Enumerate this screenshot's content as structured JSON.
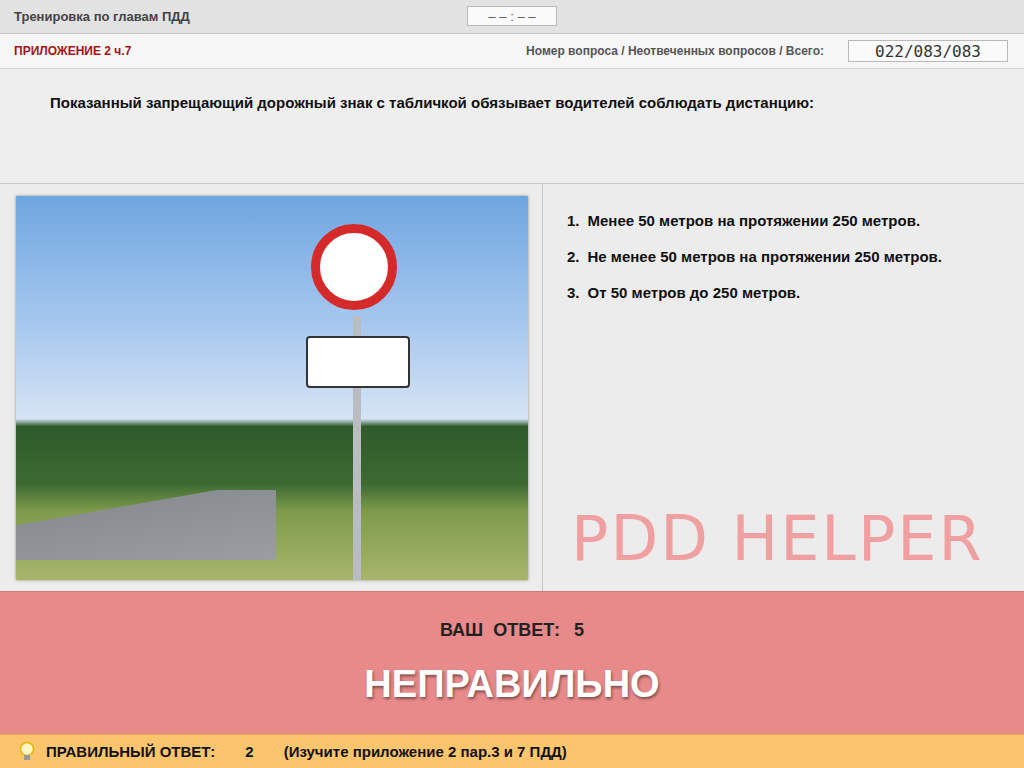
{
  "header": {
    "title": "Тренировка по главам ПДД",
    "timer": "– – : – –"
  },
  "info": {
    "section": "ПРИЛОЖЕНИЕ 2 ч.7",
    "counter_label": "Номер вопроса / Неотвеченных вопросов / Всего:",
    "counter": "022/083/083"
  },
  "question": "Показанный запрещающий дорожный знак с табличкой обязывает водителей соблюдать дистанцию:",
  "answers": [
    {
      "number": "1.",
      "text": "Менее 50 метров на протяжении 250 метров."
    },
    {
      "number": "2.",
      "text": "Не менее 50 метров на протяжении 250 метров."
    },
    {
      "number": "3.",
      "text": "От 50 метров до 250 метров."
    }
  ],
  "watermark": "PDD HELPER",
  "result": {
    "label": "ВАШ  ОТВЕТ:",
    "value": "5",
    "verdict": "НЕПРАВИЛЬНО"
  },
  "hint": {
    "label": "ПРАВИЛЬНЫЙ ОТВЕТ:",
    "value": "2",
    "note": "(Изучите приложение 2 пар.3 и 7 ПДД)"
  }
}
